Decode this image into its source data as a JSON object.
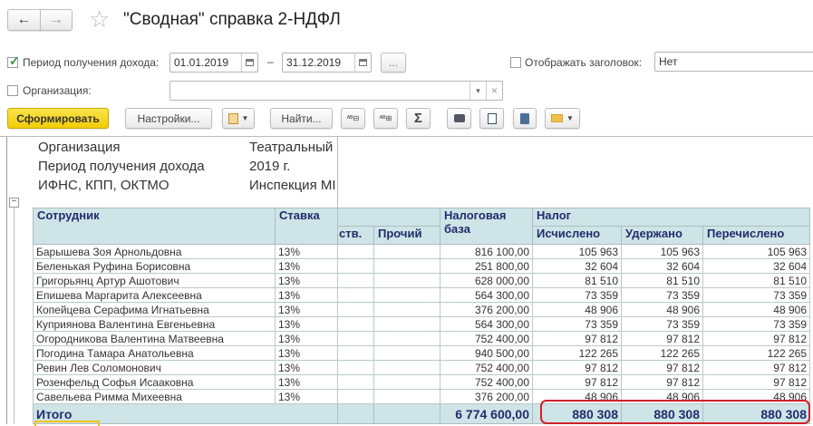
{
  "window": {
    "title": "\"Сводная\" справка 2-НДФЛ",
    "back_icon": "←",
    "forward_icon": "→",
    "favorite_icon": "☆"
  },
  "filters": {
    "period": {
      "checked": true,
      "label": "Период получения дохода:",
      "from": "01.01.2019",
      "dash": "–",
      "to": "31.12.2019",
      "more": "..."
    },
    "show_header": {
      "checked": false,
      "label": "Отображать заголовок:",
      "value": "Нет"
    },
    "organization": {
      "checked": false,
      "label": "Организация:",
      "value": "",
      "dropdown_icon": "▾",
      "clear_icon": "×"
    }
  },
  "toolbar": {
    "generate": "Сформировать",
    "settings": "Настройки...",
    "find": "Найти...",
    "sum_icon": "Σ"
  },
  "report": {
    "info": [
      {
        "label": "Организация",
        "value": "Театральный"
      },
      {
        "label": "Период получения дохода",
        "value": "2019 г."
      },
      {
        "label": "ИФНС, КПП, ОКТМО",
        "value": "Инспекция МІ"
      }
    ],
    "headers": {
      "employee": "Сотрудник",
      "rate": "Ставка",
      "col_cut": "ств.",
      "other": "Прочий",
      "tax_base_1": "Налоговая",
      "tax_base_2": "база",
      "tax": "Налог",
      "calculated": "Исчислено",
      "withheld": "Удержано",
      "transferred": "Перечислено"
    },
    "rows": [
      {
        "name": "Барышева Зоя Арнольдовна",
        "rate": "13%",
        "base": "816 100,00",
        "calc": "105 963",
        "withheld": "105 963",
        "transferred": "105 963"
      },
      {
        "name": "Беленькая Руфина Борисовна",
        "rate": "13%",
        "base": "251 800,00",
        "calc": "32 604",
        "withheld": "32 604",
        "transferred": "32 604"
      },
      {
        "name": "Григорьянц Артур Ашотович",
        "rate": "13%",
        "base": "628 000,00",
        "calc": "81 510",
        "withheld": "81 510",
        "transferred": "81 510"
      },
      {
        "name": "Епишева Маргарита Алексеевна",
        "rate": "13%",
        "base": "564 300,00",
        "calc": "73 359",
        "withheld": "73 359",
        "transferred": "73 359"
      },
      {
        "name": "Копейцева Серафима Игнатьевна",
        "rate": "13%",
        "base": "376 200,00",
        "calc": "48 906",
        "withheld": "48 906",
        "transferred": "48 906"
      },
      {
        "name": "Куприянова Валентина Евгеньевна",
        "rate": "13%",
        "base": "564 300,00",
        "calc": "73 359",
        "withheld": "73 359",
        "transferred": "73 359"
      },
      {
        "name": "Огородникова Валентина Матвеевна",
        "rate": "13%",
        "base": "752 400,00",
        "calc": "97 812",
        "withheld": "97 812",
        "transferred": "97 812"
      },
      {
        "name": "Погодина Тамара Анатольевна",
        "rate": "13%",
        "base": "940 500,00",
        "calc": "122 265",
        "withheld": "122 265",
        "transferred": "122 265"
      },
      {
        "name": "Ревин Лев Соломонович",
        "rate": "13%",
        "base": "752 400,00",
        "calc": "97 812",
        "withheld": "97 812",
        "transferred": "97 812"
      },
      {
        "name": "Розенфельд Софья Исааковна",
        "rate": "13%",
        "base": "752 400,00",
        "calc": "97 812",
        "withheld": "97 812",
        "transferred": "97 812"
      },
      {
        "name": "Савельева Римма Михеевна",
        "rate": "13%",
        "base": "376 200,00",
        "calc": "48 906",
        "withheld": "48 906",
        "transferred": "48 906"
      }
    ],
    "total": {
      "label": "Итого",
      "base": "6 774 600,00",
      "calc": "880 308",
      "withheld": "880 308",
      "transferred": "880 308"
    }
  },
  "colors": {
    "accent_yellow": "#f5d20f",
    "header_bg": "#cfe4e7",
    "highlight_red": "#d0212a"
  }
}
